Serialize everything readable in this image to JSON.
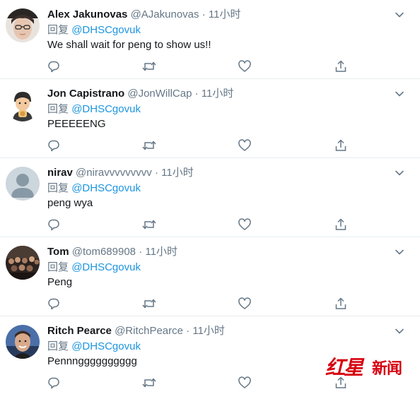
{
  "reply_prefix": "回复",
  "colors": {
    "mention": "#1b95e0",
    "meta_gray": "#657786",
    "divider": "#e6ecf0",
    "watermark_red": "#d7000f"
  },
  "icons": {
    "reply": "reply-icon",
    "retweet": "retweet-icon",
    "like": "heart-icon",
    "share": "share-icon",
    "menu": "chevron-down-icon"
  },
  "tweets": [
    {
      "name": "Alex Jakunovas",
      "handle": "@AJakunovas",
      "dot": "·",
      "time": "11小时",
      "reply_to": "@DHSCgovuk",
      "text": "We shall wait for peng to show us!!"
    },
    {
      "name": "Jon Capistrano",
      "handle": "@JonWillCap",
      "dot": "·",
      "time": "11小时",
      "reply_to": "@DHSCgovuk",
      "text": "PEEEEENG"
    },
    {
      "name": "nirav",
      "handle": "@niravvvvvvvvv",
      "dot": "·",
      "time": "11小时",
      "reply_to": "@DHSCgovuk",
      "text": "peng wya"
    },
    {
      "name": "Tom",
      "handle": "@tom689908",
      "dot": "·",
      "time": "11小时",
      "reply_to": "@DHSCgovuk",
      "text": "Peng"
    },
    {
      "name": "Ritch Pearce",
      "handle": "@RitchPearce",
      "dot": "·",
      "time": "11小时",
      "reply_to": "@DHSCgovuk",
      "text": "Pennngggggggggg"
    }
  ],
  "watermark": {
    "part1": "红星",
    "part2": "新闻"
  }
}
